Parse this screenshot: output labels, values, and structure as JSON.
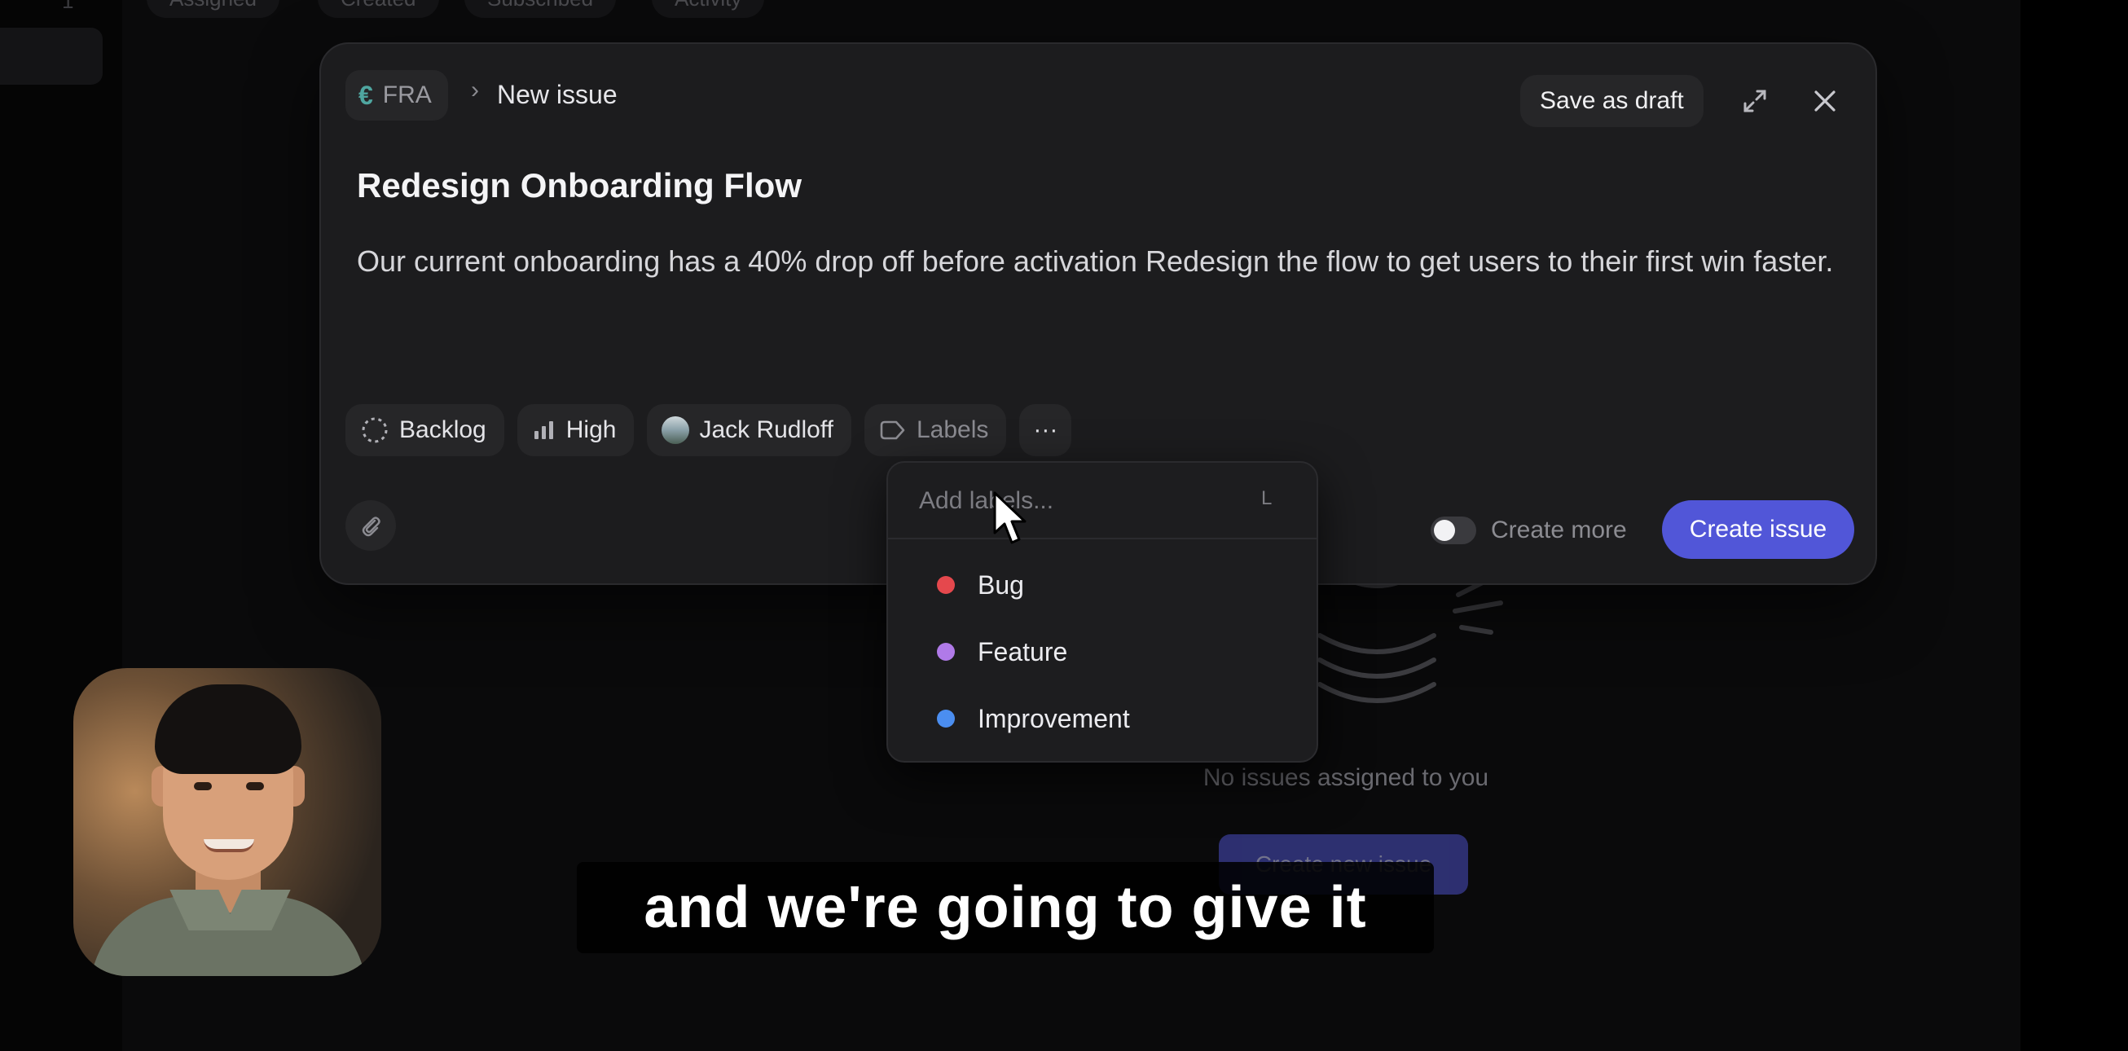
{
  "background": {
    "rail_number": "1",
    "tabs": [
      "Assigned",
      "Created",
      "Subscribed",
      "Activity"
    ],
    "empty_state": {
      "message": "No issues assigned to you",
      "button_label": "Create new issue"
    }
  },
  "modal": {
    "team_code": "FRA",
    "team_icon": "€",
    "breadcrumb_separator": "›",
    "breadcrumb_title": "New issue",
    "save_draft_label": "Save as draft",
    "issue_title": "Redesign Onboarding Flow",
    "issue_description": "Our current onboarding has a 40% drop off before activation Redesign the flow to get users to their first win faster.",
    "properties": {
      "status": "Backlog",
      "priority": "High",
      "assignee": "Jack Rudloff",
      "labels": "Labels",
      "more": "···"
    },
    "create_more_label": "Create more",
    "create_more_enabled": false,
    "create_button_label": "Create issue",
    "accent_color": "#5156d8"
  },
  "labels_dropdown": {
    "placeholder": "Add labels...",
    "shortcut": "L",
    "options": [
      {
        "name": "Bug",
        "color": "#e5484d"
      },
      {
        "name": "Feature",
        "color": "#b07ae8"
      },
      {
        "name": "Improvement",
        "color": "#4b8ef0"
      }
    ]
  },
  "subtitle": "and we're going to give it"
}
